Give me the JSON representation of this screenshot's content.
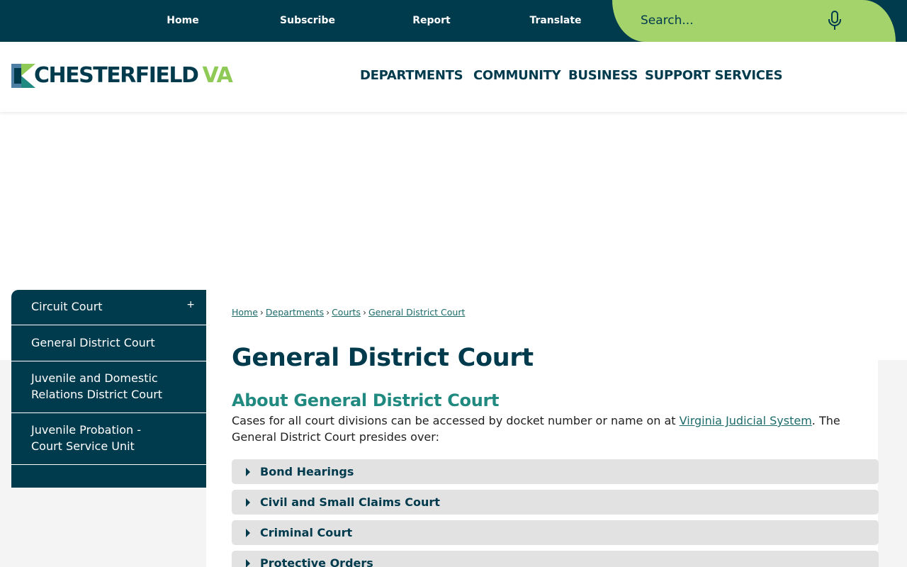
{
  "topnav": [
    {
      "label": "Home"
    },
    {
      "label": "Subscribe"
    },
    {
      "label": "Report"
    },
    {
      "label": "Translate"
    }
  ],
  "search": {
    "placeholder": "Search...",
    "icon": "microphone-icon"
  },
  "logo": {
    "main": "CHESTERFIELD",
    "suffix": "VA"
  },
  "mainnav": [
    {
      "label": "DEPARTMENTS"
    },
    {
      "label": "COMMUNITY"
    },
    {
      "label": "BUSINESS"
    },
    {
      "label": "SUPPORT SERVICES"
    }
  ],
  "sidebar": {
    "items": [
      {
        "label": "Circuit Court",
        "toggle": "+"
      },
      {
        "label": "General District Court"
      },
      {
        "label": "Juvenile and Domestic Relations District Court"
      },
      {
        "label": "Juvenile Probation - Court Service Unit"
      }
    ]
  },
  "breadcrumb": [
    {
      "label": "Home"
    },
    {
      "label": "Departments"
    },
    {
      "label": "Courts"
    },
    {
      "label": "General District Court"
    }
  ],
  "breadcrumb_sep": "›",
  "main": {
    "title": "General District Court",
    "section_title": "About General District Court",
    "intro_before": "Cases for all court divisions can be accessed by docket number or name on at ",
    "intro_link": "Virginia Judicial System",
    "intro_after": ". The General District Court presides over:",
    "accordions": [
      {
        "label": "Bond Hearings"
      },
      {
        "label": "Civil and Small Claims Court"
      },
      {
        "label": "Criminal Court"
      },
      {
        "label": "Protective Orders"
      }
    ]
  },
  "colors": {
    "brand_dark": "#003a4d",
    "brand_green": "#a4d36b",
    "accent_teal": "#218a80"
  }
}
